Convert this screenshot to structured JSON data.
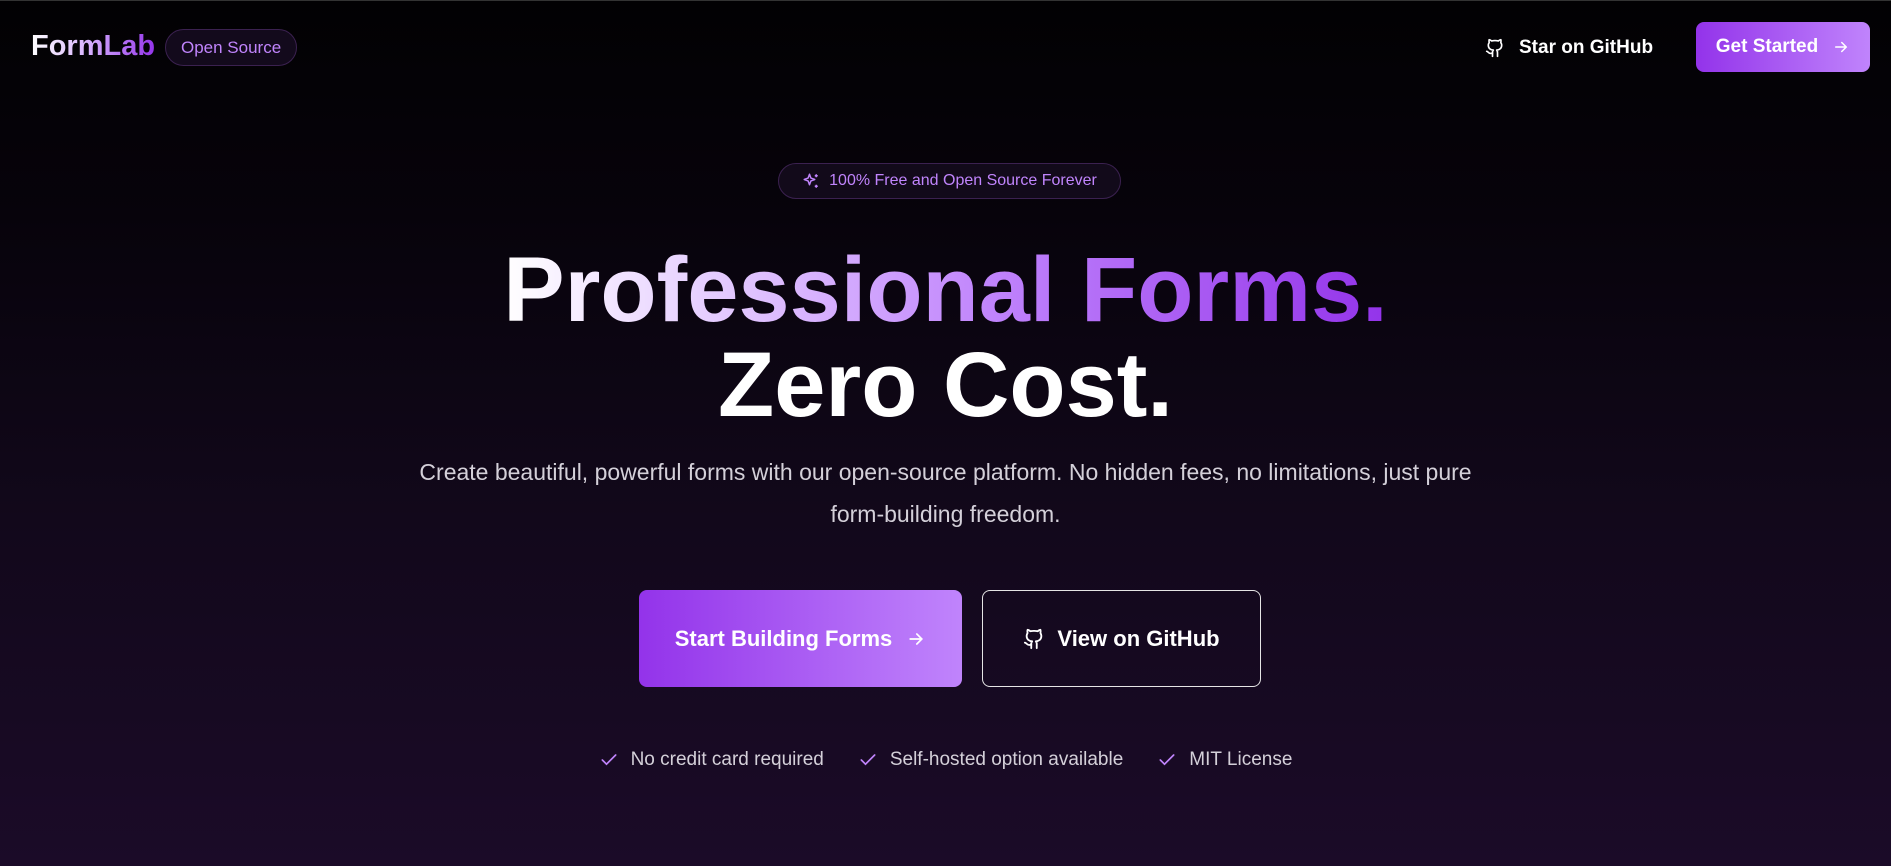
{
  "nav": {
    "logo": "FormLab",
    "badge": "Open Source",
    "star_label": "Star on GitHub",
    "cta_label": "Get Started"
  },
  "hero": {
    "pill": "100% Free and Open Source Forever",
    "headline_line1": "Professional Forms.",
    "headline_line2": "Zero Cost.",
    "subtitle": "Create beautiful, powerful forms with our open-source platform. No hidden fees, no limitations, just pure form-building freedom.",
    "primary_button": "Start Building Forms",
    "secondary_button": "View on GitHub",
    "checks": [
      "No credit card required",
      "Self-hosted option available",
      "MIT License"
    ]
  },
  "colors": {
    "accent": "#9333ea",
    "accent_light": "#c084fc"
  }
}
